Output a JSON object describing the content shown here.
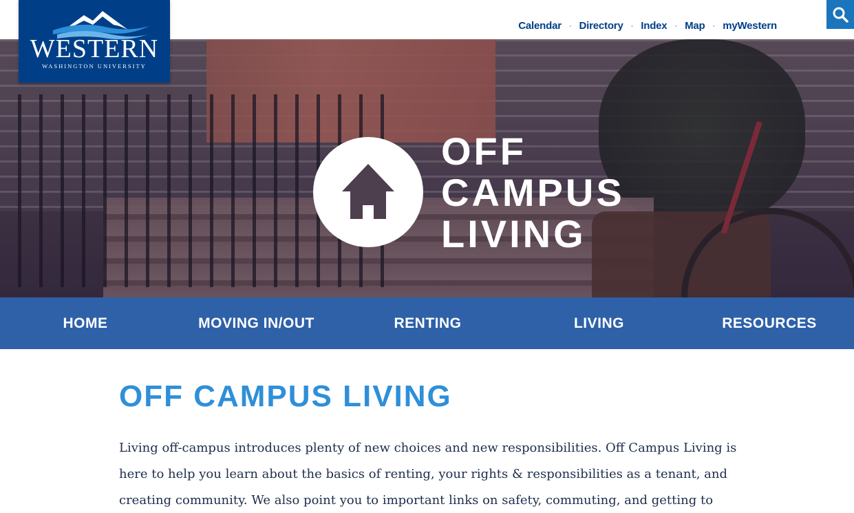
{
  "header": {
    "logo": {
      "wordmark": "WESTERN",
      "subline": "WASHINGTON UNIVERSITY"
    },
    "utility_links": [
      {
        "label": "Calendar"
      },
      {
        "label": "Directory"
      },
      {
        "label": "Index"
      },
      {
        "label": "Map"
      },
      {
        "label": "myWestern"
      }
    ],
    "separator": "·",
    "search_icon": "search-icon"
  },
  "hero": {
    "icon": "house-icon",
    "title_lines": [
      "OFF",
      "CAMPUS",
      "LIVING"
    ]
  },
  "nav": {
    "items": [
      {
        "label": "HOME"
      },
      {
        "label": "MOVING IN/OUT"
      },
      {
        "label": "RENTING"
      },
      {
        "label": "LIVING"
      },
      {
        "label": "RESOURCES"
      }
    ]
  },
  "main": {
    "title": "OFF CAMPUS LIVING",
    "intro": "Living off-campus introduces plenty of new choices and new responsibilities. Off Campus Living is here to help you learn about the basics of renting, your rights & responsibilities as a tenant, and creating community. We also point you to important links on safety, commuting, and getting to"
  },
  "colors": {
    "brand_navy": "#003f87",
    "nav_blue": "#2e61a8",
    "title_blue": "#2f8fd8",
    "search_blue": "#1b75bc",
    "body_text": "#1e2e4a"
  }
}
